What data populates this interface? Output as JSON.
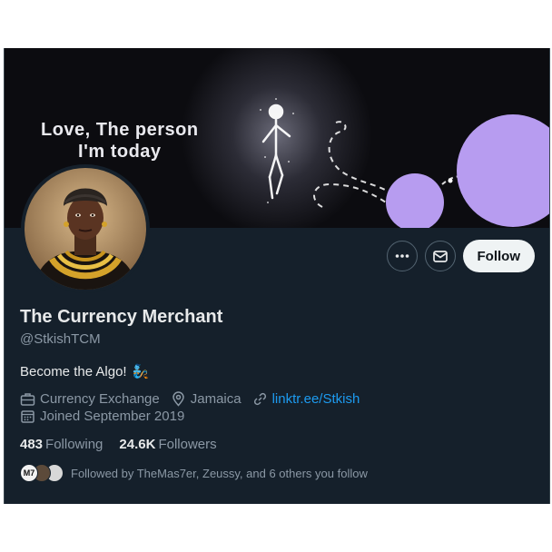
{
  "banner": {
    "line1": "Love, The person",
    "line2": "I'm today"
  },
  "profile": {
    "name": "The Currency Merchant",
    "handle": "@StkishTCM",
    "bio": "Become the Algo!",
    "bio_emoji": "🧞",
    "category": "Currency Exchange",
    "location": "Jamaica",
    "website": "linktr.ee/Stkish",
    "joined": "Joined September 2019"
  },
  "actions": {
    "more_icon": "more-horizontal-icon",
    "message_icon": "envelope-icon",
    "follow_label": "Follow"
  },
  "stats": {
    "following_count": "483",
    "following_label": "Following",
    "followers_count": "24.6K",
    "followers_label": "Followers"
  },
  "followed_by": {
    "text": "Followed by TheMas7er, Zeussy, and 6 others you follow",
    "avatar_label": "M7"
  },
  "colors": {
    "background": "#15202b",
    "accent": "#1d9bf0",
    "text_primary": "#e7e9ea",
    "text_secondary": "#8b98a5",
    "follow_button": "#eff3f4",
    "banner_circle": "#b79cf0"
  }
}
